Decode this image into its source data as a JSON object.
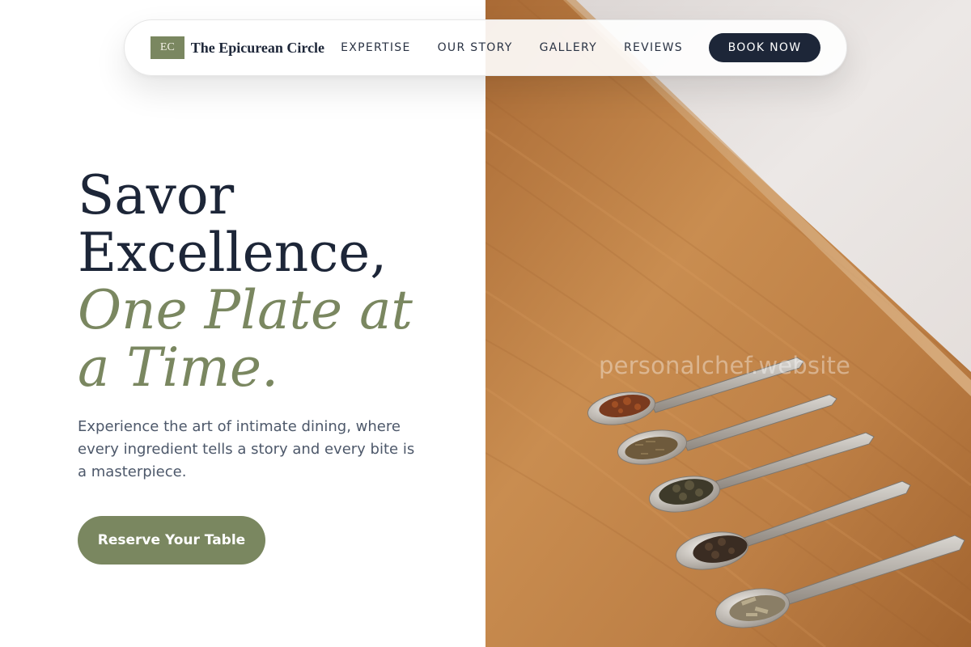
{
  "brand": {
    "logo_initials": "EC",
    "name": "The Epicurean Circle"
  },
  "nav": {
    "links": [
      "EXPERTISE",
      "OUR STORY",
      "GALLERY",
      "REVIEWS"
    ],
    "book_label": "BOOK NOW"
  },
  "hero": {
    "title_line_1": "Savor",
    "title_line_2": "Excellence,",
    "title_accent_1": "One Plate at",
    "title_accent_2": "a Time.",
    "subtitle": "Experience the art of intimate dining, where every ingredient tells a story and every bite is a masterpiece.",
    "cta_label": "Reserve Your Table"
  },
  "image": {
    "watermark": "personalchef.website"
  },
  "colors": {
    "navy": "#1d2638",
    "olive": "#7a8760",
    "body_text": "#4d586a",
    "wood": "#c08040",
    "wall": "#eae6e4"
  }
}
